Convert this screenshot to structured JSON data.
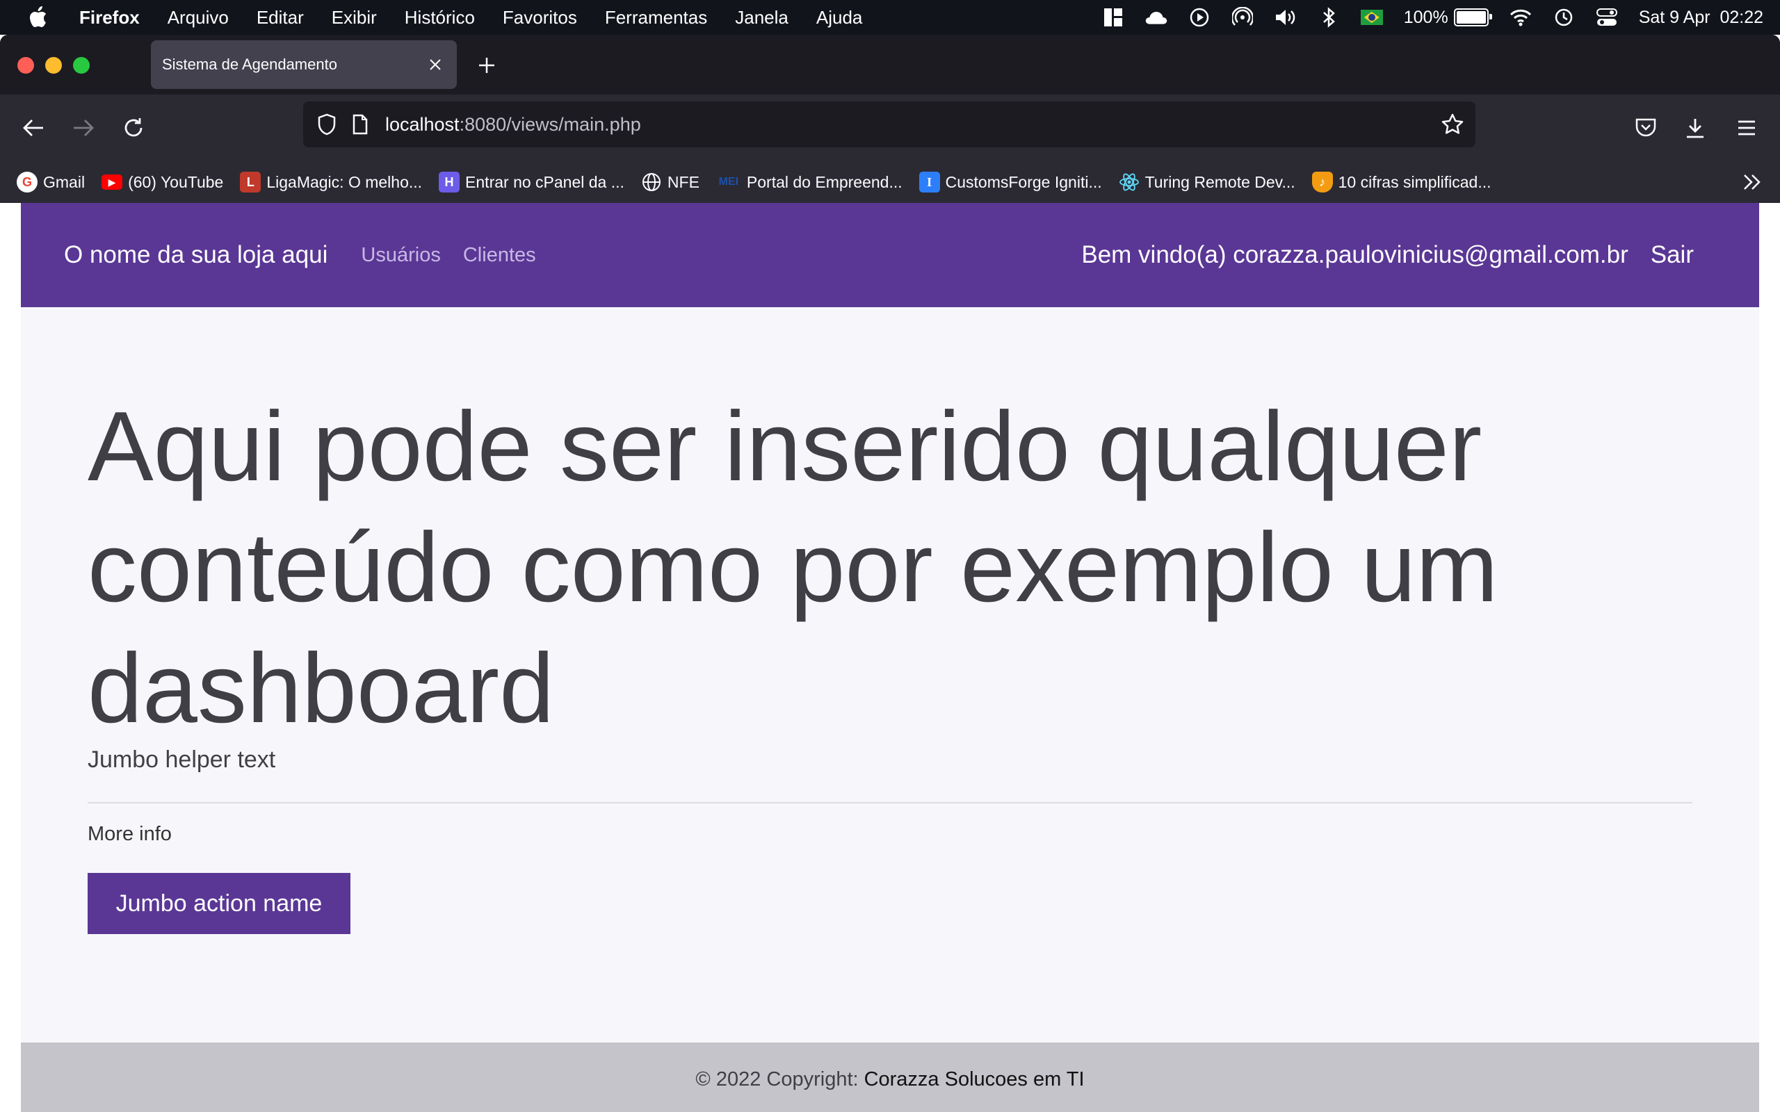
{
  "menubar": {
    "app_name": "Firefox",
    "menus": [
      "Arquivo",
      "Editar",
      "Exibir",
      "Histórico",
      "Favoritos",
      "Ferramentas",
      "Janela",
      "Ajuda"
    ],
    "battery": "100%",
    "battery_level": 1.0,
    "datetime": "Sat 9 Apr  02:22"
  },
  "browser": {
    "tab_title": "Sistema de Agendamento",
    "url_host": "localhost",
    "url_rest": ":8080/views/main.php",
    "bookmarks": [
      {
        "label": "Gmail",
        "icon": "google-icon",
        "color": "#ea4335"
      },
      {
        "label": "(60) YouTube",
        "icon": "youtube-icon",
        "color": "#ff0000"
      },
      {
        "label": "LigaMagic: O melho...",
        "icon": "ligamagic-icon",
        "color": "#c0392b"
      },
      {
        "label": "Entrar no cPanel da ...",
        "icon": "cpanel-icon",
        "color": "#6c5ce7"
      },
      {
        "label": "NFE",
        "icon": "globe-icon",
        "color": "#fbfbfe"
      },
      {
        "label": "Portal do Empreend...",
        "icon": "mei-icon",
        "color": "#1e4fa8"
      },
      {
        "label": "CustomsForge Igniti...",
        "icon": "customsforge-icon",
        "color": "#2d7ff9"
      },
      {
        "label": "Turing Remote Dev...",
        "icon": "react-icon",
        "color": "#61dafb"
      },
      {
        "label": "10 cifras simplificad...",
        "icon": "cifras-icon",
        "color": "#f39c12"
      }
    ]
  },
  "site": {
    "brand": "O nome da sua loja aqui",
    "nav_links": [
      "Usuários",
      "Clientes"
    ],
    "welcome": "Bem vindo(a) corazza.paulovinicius@gmail.com.br",
    "logout": "Sair",
    "jumbo_title": "Aqui pode ser inserido qualquer conteúdo como por exemplo um dashboard",
    "jumbo_helper": "Jumbo helper text",
    "more_info": "More info",
    "jumbo_button": "Jumbo action name",
    "footer_prefix": "© 2022 Copyright:",
    "footer_company": "Corazza Solucoes em TI"
  },
  "colors": {
    "accent": "#5a3795",
    "page_bg": "#f7f7fb",
    "footer_bg": "#c5c4cb"
  }
}
